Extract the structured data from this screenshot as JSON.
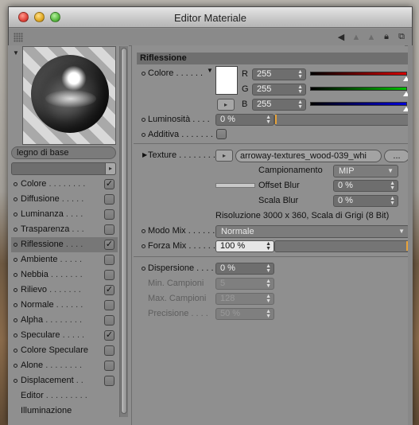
{
  "window": {
    "title": "Editor Materiale"
  },
  "material": {
    "name": "legno di base"
  },
  "channels": [
    {
      "label": "Colore",
      "dots": " . . . . . . . .",
      "checked": true
    },
    {
      "label": "Diffusione",
      "dots": " . . . . .",
      "checked": false
    },
    {
      "label": "Luminanza",
      "dots": " . . . .",
      "checked": false
    },
    {
      "label": "Trasparenza",
      "dots": " . . .",
      "checked": false
    },
    {
      "label": "Riflessione",
      "dots": " . . . .",
      "checked": true,
      "active": true
    },
    {
      "label": "Ambiente",
      "dots": " . . . . .",
      "checked": false
    },
    {
      "label": "Nebbia",
      "dots": " . . . . . . .",
      "checked": false
    },
    {
      "label": "Rilievo",
      "dots": " . . . . . . .",
      "checked": true
    },
    {
      "label": "Normale",
      "dots": " . . . . . .",
      "checked": false
    },
    {
      "label": "Alpha",
      "dots": " . . . . . . . .",
      "checked": false
    },
    {
      "label": "Speculare",
      "dots": " . . . . .",
      "checked": true
    },
    {
      "label": "Colore Speculare",
      "dots": "",
      "checked": false
    },
    {
      "label": "Alone",
      "dots": " . . . . . . . .",
      "checked": false
    },
    {
      "label": "Displacement",
      "dots": " . .",
      "checked": false
    },
    {
      "label": "Editor",
      "dots": " . . . . . . . . .",
      "checked": null
    },
    {
      "label": "Illuminazione",
      "dots": "",
      "checked": null
    }
  ],
  "section": {
    "title": "Riflessione"
  },
  "colore": {
    "label": "Colore . . . . . .",
    "r_label": "R",
    "g_label": "G",
    "b_label": "B",
    "r": "255",
    "g": "255",
    "b": "255"
  },
  "luminosita": {
    "label": "Luminosità . . . .",
    "value": "0 %"
  },
  "additiva": {
    "label": "Additiva . . . . . . ."
  },
  "texture": {
    "label": "Texture . . . . . . . . .",
    "file": "arroway-textures_wood-039_whi",
    "more_button": "...",
    "campionamento_label": "Campionamento",
    "campionamento_value": "MIP",
    "offset_blur_label": "Offset Blur",
    "offset_blur_value": "0 %",
    "scala_blur_label": "Scala Blur",
    "scala_blur_value": "0 %",
    "info": "Risoluzione 3000 x 360, Scala di Grigi (8 Bit)"
  },
  "modo_mix": {
    "label": "Modo Mix . . . . . . .",
    "value": "Normale"
  },
  "forza_mix": {
    "label": "Forza Mix . . . . . . .",
    "value": "100 %",
    "fraction": 1.0
  },
  "dispersione": {
    "label": "Dispersione . . . .",
    "value": "0 %",
    "min_campioni_label": "Min. Campioni",
    "min_campioni_value": "5",
    "max_campioni_label": "Max. Campioni",
    "max_campioni_value": "128",
    "precisione_label": "Precisione . . . .",
    "precisione_value": "50 %"
  },
  "colors": {
    "red": "#d40000",
    "green": "#00c000",
    "blue": "#0000d8",
    "accent_orange": "#e8a33a"
  }
}
